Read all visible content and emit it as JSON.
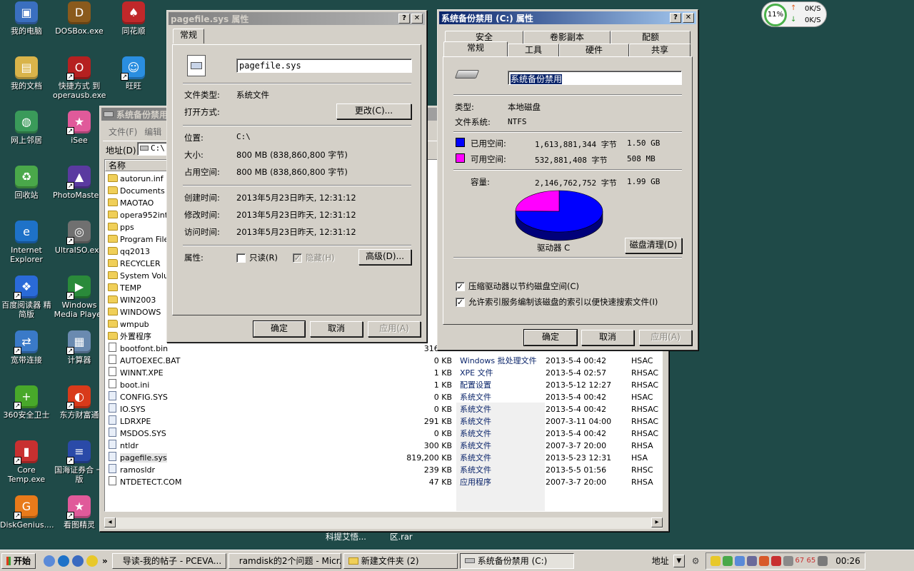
{
  "desktop": {
    "icons": [
      {
        "label": "我的电脑",
        "color": "#3a6fbf",
        "glyph": "▣",
        "shortcut": false
      },
      {
        "label": "DOSBox.exe",
        "color": "#8a5a1c",
        "glyph": "D",
        "shortcut": false
      },
      {
        "label": "同花顺",
        "color": "#c0282a",
        "glyph": "♠",
        "shortcut": false
      },
      {
        "label": "我的文档",
        "color": "#d9b44a",
        "glyph": "▤",
        "shortcut": false
      },
      {
        "label": "快捷方式 到 operausb.exe",
        "color": "#b52020",
        "glyph": "O",
        "shortcut": true
      },
      {
        "label": "旺旺",
        "color": "#2a8ee0",
        "glyph": "☺",
        "shortcut": true
      },
      {
        "label": "网上邻居",
        "color": "#3a9a5a",
        "glyph": "◍",
        "shortcut": false
      },
      {
        "label": "iSee",
        "color": "#e05a9a",
        "glyph": "★",
        "shortcut": true
      },
      {
        "label": "回收站",
        "color": "#4aa84a",
        "glyph": "♻",
        "shortcut": false
      },
      {
        "label": "PhotoMaste...",
        "color": "#5a3aa0",
        "glyph": "▲",
        "shortcut": true
      },
      {
        "label": "Internet Explorer",
        "color": "#1e72c8",
        "glyph": "e",
        "shortcut": false
      },
      {
        "label": "UltraISO.exe",
        "color": "#707070",
        "glyph": "◎",
        "shortcut": true
      },
      {
        "label": "百度阅读器 精简版",
        "color": "#2a6ad8",
        "glyph": "❖",
        "shortcut": true
      },
      {
        "label": "Windows Media Player",
        "color": "#2a8a3a",
        "glyph": "▶",
        "shortcut": true
      },
      {
        "label": "宽带连接",
        "color": "#3a7ac8",
        "glyph": "⇄",
        "shortcut": true
      },
      {
        "label": "计算器",
        "color": "#6a8ab0",
        "glyph": "▦",
        "shortcut": true
      },
      {
        "label": "360安全卫士",
        "color": "#48a82a",
        "glyph": "+",
        "shortcut": true
      },
      {
        "label": "东方财富通",
        "color": "#d83a1a",
        "glyph": "◐",
        "shortcut": true
      },
      {
        "label": "Core Temp.exe",
        "color": "#c83030",
        "glyph": "▮",
        "shortcut": true
      },
      {
        "label": "国海证券合 一版",
        "color": "#2a4aa8",
        "glyph": "≡",
        "shortcut": true
      },
      {
        "label": "DiskGenius....",
        "color": "#e87a1a",
        "glyph": "G",
        "shortcut": true
      },
      {
        "label": "看图精灵",
        "color": "#e05a9a",
        "glyph": "★",
        "shortcut": true
      }
    ],
    "bottom_labels": [
      "科提艾悟...",
      "区.rar"
    ]
  },
  "netmeter": {
    "percent": "11%",
    "up": "0K/S",
    "down": "0K/S"
  },
  "explorer": {
    "title": "系统备份禁用",
    "menus": [
      "文件(F)",
      "编辑"
    ],
    "address_label": "地址(D)",
    "address_value": "C:\\",
    "column_name": "名称",
    "folders": [
      "autorun.inf",
      "Documents and Settings",
      "MAOTAO",
      "opera952int",
      "pps",
      "Program Files",
      "qq2013",
      "RECYCLER",
      "System Volume Information",
      "TEMP",
      "WIN2003",
      "WINDOWS",
      "wmpub",
      "外置程序"
    ],
    "files": [
      {
        "name": "bootfont.bin",
        "size": "316 KB",
        "type": "",
        "date": "",
        "attr": ""
      },
      {
        "name": "AUTOEXEC.BAT",
        "size": "0 KB",
        "type": "Windows 批处理文件",
        "date": "2013-5-4 00:42",
        "attr": "HSAC"
      },
      {
        "name": "WINNT.XPE",
        "size": "1 KB",
        "type": "XPE 文件",
        "date": "2013-5-4 02:57",
        "attr": "RHSAC"
      },
      {
        "name": "boot.ini",
        "size": "1 KB",
        "type": "配置设置",
        "date": "2013-5-12 12:27",
        "attr": "RHSAC"
      },
      {
        "name": "CONFIG.SYS",
        "size": "0 KB",
        "type": "系统文件",
        "date": "2013-5-4 00:42",
        "attr": "HSAC"
      },
      {
        "name": "IO.SYS",
        "size": "0 KB",
        "type": "系统文件",
        "date": "2013-5-4 00:42",
        "attr": "RHSAC"
      },
      {
        "name": "LDRXPE",
        "size": "291 KB",
        "type": "系统文件",
        "date": "2007-3-11 04:00",
        "attr": "RHSAC"
      },
      {
        "name": "MSDOS.SYS",
        "size": "0 KB",
        "type": "系统文件",
        "date": "2013-5-4 00:42",
        "attr": "RHSAC"
      },
      {
        "name": "ntldr",
        "size": "300 KB",
        "type": "系统文件",
        "date": "2007-3-7 20:00",
        "attr": "RHSA"
      },
      {
        "name": "pagefile.sys",
        "size": "819,200 KB",
        "type": "系统文件",
        "date": "2013-5-23 12:31",
        "attr": "HSA"
      },
      {
        "name": "ramosldr",
        "size": "239 KB",
        "type": "系统文件",
        "date": "2013-5-5 01:56",
        "attr": "RHSC"
      },
      {
        "name": "NTDETECT.COM",
        "size": "47 KB",
        "type": "应用程序",
        "date": "2007-3-7 20:00",
        "attr": "RHSA"
      }
    ]
  },
  "pagefile_dialog": {
    "title": "pagefile.sys 属性",
    "tab": "常规",
    "filename": "pagefile.sys",
    "type_label": "文件类型:",
    "type_value": "系统文件",
    "open_label": "打开方式:",
    "change_button": "更改(C)...",
    "location_label": "位置:",
    "location_value": "C:\\",
    "size_label": "大小:",
    "size_value": "800 MB (838,860,800 字节)",
    "disk_label": "占用空间:",
    "disk_value": "800 MB (838,860,800 字节)",
    "created_label": "创建时间:",
    "created_value": "2013年5月23日昨天, 12:31:12",
    "modified_label": "修改时间:",
    "modified_value": "2013年5月23日昨天, 12:31:12",
    "accessed_label": "访问时间:",
    "accessed_value": "2013年5月23日昨天, 12:31:12",
    "attr_label": "属性:",
    "readonly": "只读(R)",
    "hidden": "隐藏(H)",
    "advanced_button": "高级(D)...",
    "ok": "确定",
    "cancel": "取消",
    "apply": "应用(A)"
  },
  "drive_dialog": {
    "title": "系统备份禁用 (C:) 属性",
    "tabs_back": [
      "安全",
      "卷影副本",
      "配额"
    ],
    "tabs_front": [
      "常规",
      "工具",
      "硬件",
      "共享"
    ],
    "name": "系统备份禁用",
    "type_label": "类型:",
    "type_value": "本地磁盘",
    "fs_label": "文件系统:",
    "fs_value": "NTFS",
    "used_label": "已用空间:",
    "used_bytes": "1,613,881,344 字节",
    "used_size": "1.50 GB",
    "free_label": "可用空间:",
    "free_bytes": "532,881,408 字节",
    "free_size": "508 MB",
    "cap_label": "容量:",
    "cap_bytes": "2,146,762,752 字节",
    "cap_size": "1.99 GB",
    "drive_label": "驱动器 C",
    "cleanup_button": "磁盘清理(D)",
    "compress_label": "压缩驱动器以节约磁盘空间(C)",
    "index_label": "允许索引服务编制该磁盘的索引以便快速搜索文件(I)",
    "ok": "确定",
    "cancel": "取消",
    "apply": "应用(A)",
    "used_color": "#0000ff",
    "free_color": "#ff00ff"
  },
  "chart_data": {
    "type": "pie",
    "categories": [
      "已用空间",
      "可用空间"
    ],
    "values": [
      1613881344,
      532881408
    ],
    "title": "驱动器 C"
  },
  "taskbar": {
    "start": "开始",
    "tasks": [
      "导读-我的帖子 - PCEVA...",
      "ramdisk的2个问题 - Micr...",
      "新建文件夹 (2)",
      "系统备份禁用 (C:)"
    ],
    "address_label": "地址",
    "clock": "00:26",
    "tray_readout": "67  65"
  }
}
